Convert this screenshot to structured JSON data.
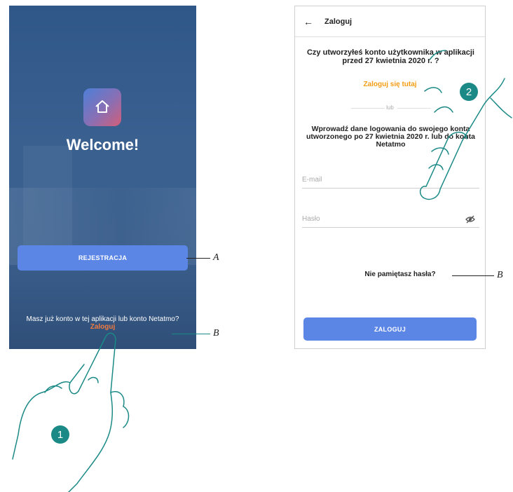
{
  "welcome_screen": {
    "title": "Welcome!",
    "register_button": "REJESTRACJA",
    "login_prompt": "Masz już konto w tej aplikacji lub konto Netatmo?",
    "login_link": "Zaloguj"
  },
  "login_screen": {
    "title": "Zaloguj",
    "question": "Czy utworzyłeś konto użytkownika w aplikacji przed 27 kwietnia 2020 r. ?",
    "login_here_link": "Zaloguj się tutaj",
    "or_text": "lub",
    "instructions": "Wprowadź dane logowania do swojego konta utworzonego po 27 kwietnia 2020 r. lub do konta Netatmo",
    "email_placeholder": "E-mail",
    "password_placeholder": "Hasło",
    "forgot_password": "Nie pamiętasz hasła?",
    "login_button": "ZALOGUJ"
  },
  "callouts": {
    "a": "A",
    "b_left": "B",
    "b_right": "B",
    "step1": "1",
    "step2": "2"
  },
  "colors": {
    "accent": "#5b86e6",
    "link_orange": "#f39c12",
    "step_teal": "#1b8a86"
  }
}
